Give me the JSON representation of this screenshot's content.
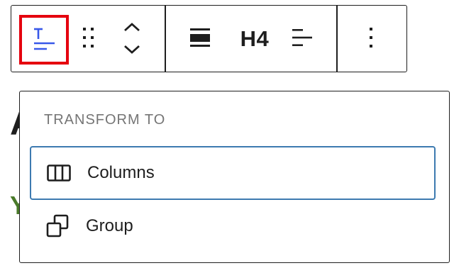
{
  "toolbar": {
    "block_type_icon": "text-icon",
    "drag_handle_icon": "drag-handle-icon",
    "move_up_icon": "chevron-up-icon",
    "move_down_icon": "chevron-down-icon",
    "align_icon": "align-none-icon",
    "heading_level": "H4",
    "text_align_icon": "align-left-icon",
    "more_options_icon": "more-vertical-icon"
  },
  "transform_menu": {
    "title": "TRANSFORM TO",
    "items": [
      {
        "label": "Columns",
        "icon": "columns-icon",
        "focused": true
      },
      {
        "label": "Group",
        "icon": "group-icon",
        "focused": false
      }
    ]
  },
  "colors": {
    "focus_outline": "#3d7ab0",
    "highlight_box": "#e5000e",
    "text": "#1e1e1e",
    "muted": "#757575",
    "accent_icon": "#3858e9"
  }
}
